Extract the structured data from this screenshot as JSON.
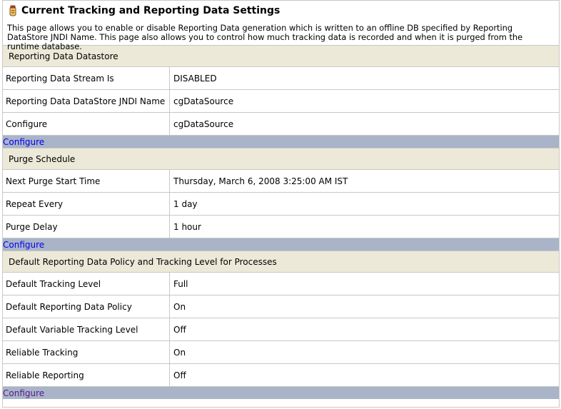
{
  "header": {
    "title": "Current Tracking and Reporting Data Settings",
    "title_icon": "jar-icon",
    "description": "This page allows you to enable or disable Reporting Data generation which is written to an offline DB specified by Reporting DataStore JNDI Name. This page also allows you to control how much tracking data is recorded and when it is purged from the runtime database."
  },
  "sections": [
    {
      "title": "Reporting Data Datastore",
      "rows": [
        {
          "label": "Reporting Data Stream Is",
          "value": "DISABLED"
        },
        {
          "label": "Reporting Data DataStore JNDI Name",
          "value": "cgDataSource"
        },
        {
          "label": "Configure",
          "value": "cgDataSource"
        }
      ],
      "link": "Configure"
    },
    {
      "title": "Purge Schedule",
      "rows": [
        {
          "label": "Next Purge Start Time",
          "value": "Thursday, March 6, 2008 3:25:00 AM IST"
        },
        {
          "label": "Repeat Every",
          "value": "1 day"
        },
        {
          "label": "Purge Delay",
          "value": "1 hour"
        }
      ],
      "link": "Configure"
    },
    {
      "title": "Default Reporting Data Policy and Tracking Level for Processes",
      "rows": [
        {
          "label": "Default Tracking Level",
          "value": "Full"
        },
        {
          "label": "Default Reporting Data Policy",
          "value": "On"
        },
        {
          "label": "Default Variable Tracking Level",
          "value": "Off"
        },
        {
          "label": "Reliable Tracking",
          "value": "On"
        },
        {
          "label": "Reliable Reporting",
          "value": "Off"
        }
      ],
      "link": "Configure"
    }
  ],
  "colors": {
    "section_header_bg": "#ece9d8",
    "link_bar_bg": "#a9b4c8",
    "link": "#0000ee",
    "link_visited": "#551a8b",
    "border": "#c8c8c8"
  }
}
